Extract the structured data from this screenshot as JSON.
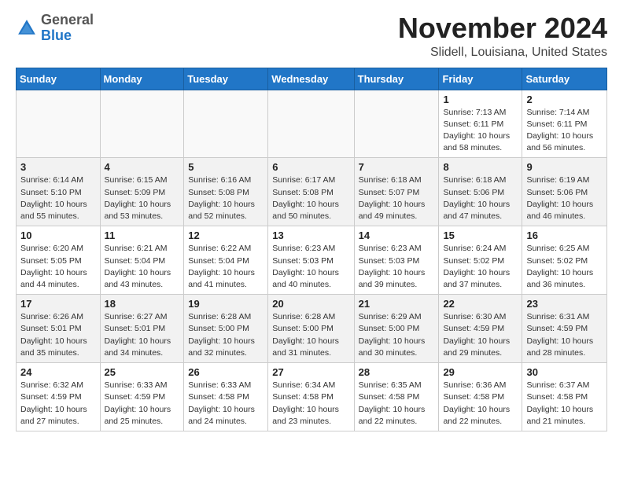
{
  "logo": {
    "general": "General",
    "blue": "Blue"
  },
  "header": {
    "month": "November 2024",
    "location": "Slidell, Louisiana, United States"
  },
  "weekdays": [
    "Sunday",
    "Monday",
    "Tuesday",
    "Wednesday",
    "Thursday",
    "Friday",
    "Saturday"
  ],
  "weeks": [
    [
      {
        "day": "",
        "info": ""
      },
      {
        "day": "",
        "info": ""
      },
      {
        "day": "",
        "info": ""
      },
      {
        "day": "",
        "info": ""
      },
      {
        "day": "",
        "info": ""
      },
      {
        "day": "1",
        "info": "Sunrise: 7:13 AM\nSunset: 6:11 PM\nDaylight: 10 hours\nand 58 minutes."
      },
      {
        "day": "2",
        "info": "Sunrise: 7:14 AM\nSunset: 6:11 PM\nDaylight: 10 hours\nand 56 minutes."
      }
    ],
    [
      {
        "day": "3",
        "info": "Sunrise: 6:14 AM\nSunset: 5:10 PM\nDaylight: 10 hours\nand 55 minutes."
      },
      {
        "day": "4",
        "info": "Sunrise: 6:15 AM\nSunset: 5:09 PM\nDaylight: 10 hours\nand 53 minutes."
      },
      {
        "day": "5",
        "info": "Sunrise: 6:16 AM\nSunset: 5:08 PM\nDaylight: 10 hours\nand 52 minutes."
      },
      {
        "day": "6",
        "info": "Sunrise: 6:17 AM\nSunset: 5:08 PM\nDaylight: 10 hours\nand 50 minutes."
      },
      {
        "day": "7",
        "info": "Sunrise: 6:18 AM\nSunset: 5:07 PM\nDaylight: 10 hours\nand 49 minutes."
      },
      {
        "day": "8",
        "info": "Sunrise: 6:18 AM\nSunset: 5:06 PM\nDaylight: 10 hours\nand 47 minutes."
      },
      {
        "day": "9",
        "info": "Sunrise: 6:19 AM\nSunset: 5:06 PM\nDaylight: 10 hours\nand 46 minutes."
      }
    ],
    [
      {
        "day": "10",
        "info": "Sunrise: 6:20 AM\nSunset: 5:05 PM\nDaylight: 10 hours\nand 44 minutes."
      },
      {
        "day": "11",
        "info": "Sunrise: 6:21 AM\nSunset: 5:04 PM\nDaylight: 10 hours\nand 43 minutes."
      },
      {
        "day": "12",
        "info": "Sunrise: 6:22 AM\nSunset: 5:04 PM\nDaylight: 10 hours\nand 41 minutes."
      },
      {
        "day": "13",
        "info": "Sunrise: 6:23 AM\nSunset: 5:03 PM\nDaylight: 10 hours\nand 40 minutes."
      },
      {
        "day": "14",
        "info": "Sunrise: 6:23 AM\nSunset: 5:03 PM\nDaylight: 10 hours\nand 39 minutes."
      },
      {
        "day": "15",
        "info": "Sunrise: 6:24 AM\nSunset: 5:02 PM\nDaylight: 10 hours\nand 37 minutes."
      },
      {
        "day": "16",
        "info": "Sunrise: 6:25 AM\nSunset: 5:02 PM\nDaylight: 10 hours\nand 36 minutes."
      }
    ],
    [
      {
        "day": "17",
        "info": "Sunrise: 6:26 AM\nSunset: 5:01 PM\nDaylight: 10 hours\nand 35 minutes."
      },
      {
        "day": "18",
        "info": "Sunrise: 6:27 AM\nSunset: 5:01 PM\nDaylight: 10 hours\nand 34 minutes."
      },
      {
        "day": "19",
        "info": "Sunrise: 6:28 AM\nSunset: 5:00 PM\nDaylight: 10 hours\nand 32 minutes."
      },
      {
        "day": "20",
        "info": "Sunrise: 6:28 AM\nSunset: 5:00 PM\nDaylight: 10 hours\nand 31 minutes."
      },
      {
        "day": "21",
        "info": "Sunrise: 6:29 AM\nSunset: 5:00 PM\nDaylight: 10 hours\nand 30 minutes."
      },
      {
        "day": "22",
        "info": "Sunrise: 6:30 AM\nSunset: 4:59 PM\nDaylight: 10 hours\nand 29 minutes."
      },
      {
        "day": "23",
        "info": "Sunrise: 6:31 AM\nSunset: 4:59 PM\nDaylight: 10 hours\nand 28 minutes."
      }
    ],
    [
      {
        "day": "24",
        "info": "Sunrise: 6:32 AM\nSunset: 4:59 PM\nDaylight: 10 hours\nand 27 minutes."
      },
      {
        "day": "25",
        "info": "Sunrise: 6:33 AM\nSunset: 4:59 PM\nDaylight: 10 hours\nand 25 minutes."
      },
      {
        "day": "26",
        "info": "Sunrise: 6:33 AM\nSunset: 4:58 PM\nDaylight: 10 hours\nand 24 minutes."
      },
      {
        "day": "27",
        "info": "Sunrise: 6:34 AM\nSunset: 4:58 PM\nDaylight: 10 hours\nand 23 minutes."
      },
      {
        "day": "28",
        "info": "Sunrise: 6:35 AM\nSunset: 4:58 PM\nDaylight: 10 hours\nand 22 minutes."
      },
      {
        "day": "29",
        "info": "Sunrise: 6:36 AM\nSunset: 4:58 PM\nDaylight: 10 hours\nand 22 minutes."
      },
      {
        "day": "30",
        "info": "Sunrise: 6:37 AM\nSunset: 4:58 PM\nDaylight: 10 hours\nand 21 minutes."
      }
    ]
  ]
}
